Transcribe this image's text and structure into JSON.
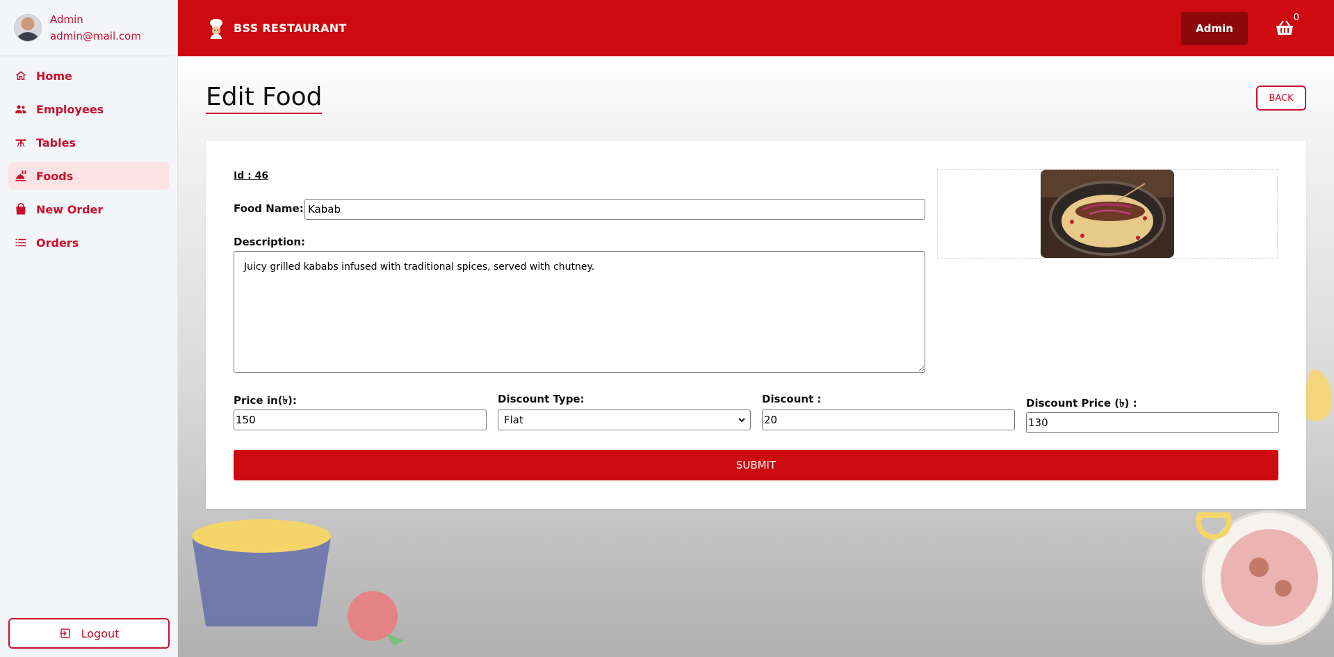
{
  "sidebar": {
    "user": {
      "name": "Admin",
      "email": "admin@mail.com"
    },
    "items": [
      {
        "label": "Home",
        "icon": "home-icon"
      },
      {
        "label": "Employees",
        "icon": "users-icon"
      },
      {
        "label": "Tables",
        "icon": "table-icon"
      },
      {
        "label": "Foods",
        "icon": "food-icon",
        "active": true
      },
      {
        "label": "New Order",
        "icon": "shopping-bag-icon"
      },
      {
        "label": "Orders",
        "icon": "list-icon"
      }
    ],
    "logout_label": "Logout"
  },
  "topbar": {
    "brand": "BSS RESTAURANT",
    "admin_label": "Admin",
    "cart_count": "0"
  },
  "page": {
    "title": "Edit Food",
    "back_label": "BACK"
  },
  "form": {
    "id_label": "Id : 46",
    "food_name_label": "Food Name:",
    "food_name_value": "Kabab",
    "description_label": "Description:",
    "description_value": "Juicy grilled kababs infused with traditional spices, served with chutney.",
    "price_label": "Price in(৳):",
    "price_value": "150",
    "discount_type_label": "Discount Type:",
    "discount_type_value": "Flat",
    "discount_label": "Discount :",
    "discount_value": "20",
    "discount_price_label": "Discount Price (৳) :",
    "discount_price_value": "130",
    "submit_label": "SUBMIT"
  },
  "colors": {
    "brand_red": "#cc0a0f",
    "accent_red": "#c8102e",
    "active_bg": "#fde3e6"
  }
}
